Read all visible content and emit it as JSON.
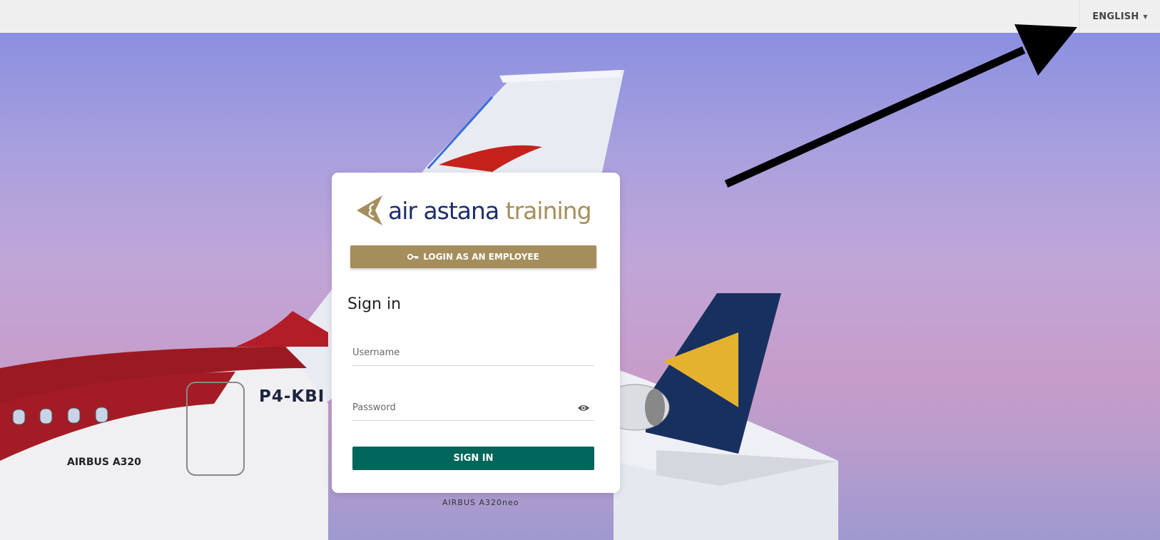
{
  "header": {
    "language": "ENGLISH"
  },
  "scene": {
    "registration": "P4-KBI",
    "aircraft_label": "AIRBUS A320",
    "aircraft_label_neo": "AIRBUS A320neo"
  },
  "login": {
    "logo_part1": "air astana",
    "logo_part2": "training",
    "employee_button": "LOGIN AS AN EMPLOYEE",
    "title": "Sign in",
    "username_placeholder": "Username",
    "password_placeholder": "Password",
    "submit_button": "SIGN IN"
  },
  "colors": {
    "brand_gold": "#a58e5c",
    "brand_navy": "#1f2d6b",
    "submit_green": "#00665b",
    "topbar_bg": "#efefef"
  },
  "icons": {
    "language_caret": "caret-down-icon",
    "employee_button_icon": "key-icon",
    "password_toggle": "eye-icon",
    "logo_emblem": "airline-emblem-icon"
  }
}
